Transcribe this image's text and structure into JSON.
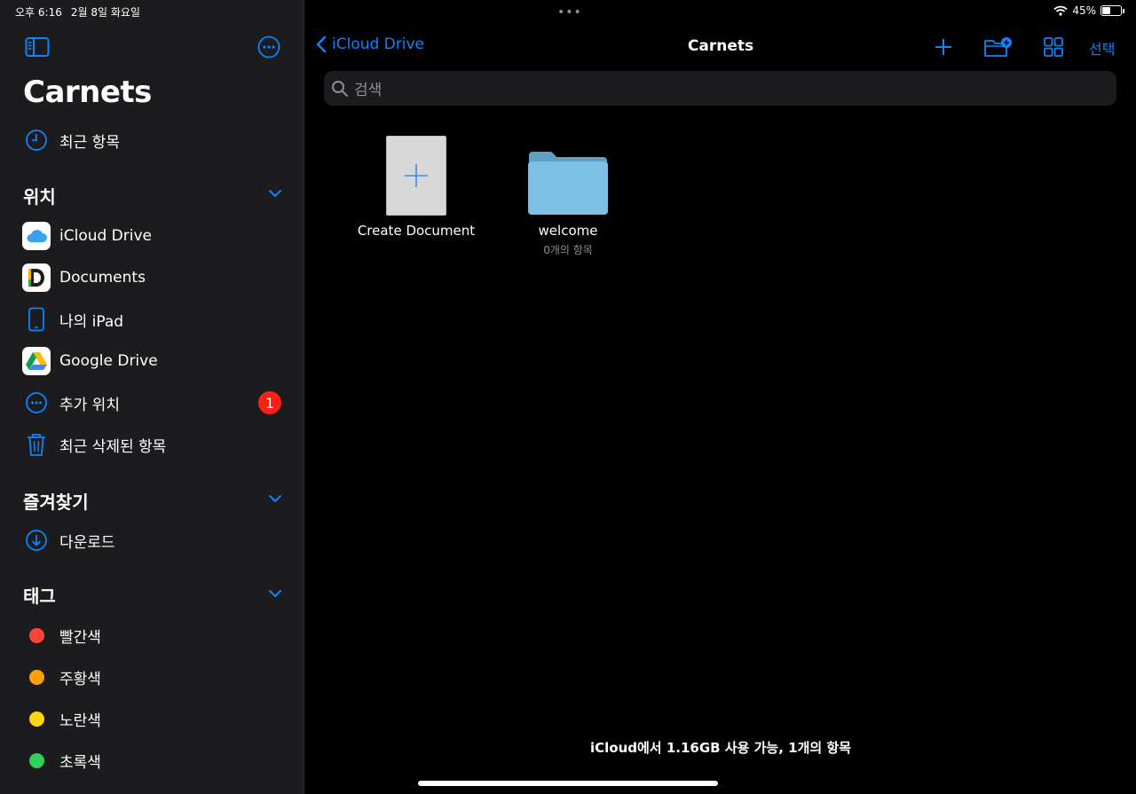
{
  "status": {
    "time": "오후 6:16",
    "date": "2월 8일 화요일",
    "battery": "45%"
  },
  "sidebar": {
    "title": "Carnets",
    "recents": "최근 항목",
    "locations": {
      "heading": "위치",
      "items": [
        {
          "label": "iCloud Drive",
          "icon": "icloud-icon"
        },
        {
          "label": "Documents",
          "icon": "documents-app-icon"
        },
        {
          "label": "나의 iPad",
          "icon": "ipad-icon"
        },
        {
          "label": "Google Drive",
          "icon": "google-drive-icon"
        },
        {
          "label": "추가 위치",
          "icon": "more-locations-icon",
          "badge": "1"
        },
        {
          "label": "최근 삭제된 항목",
          "icon": "trash-icon"
        }
      ]
    },
    "favorites": {
      "heading": "즐겨찾기",
      "items": [
        {
          "label": "다운로드",
          "icon": "download-icon"
        }
      ]
    },
    "tags": {
      "heading": "태그",
      "items": [
        {
          "label": "빨간색",
          "color": "#ff453a"
        },
        {
          "label": "주황색",
          "color": "#ff9f0a"
        },
        {
          "label": "노란색",
          "color": "#ffd60a"
        },
        {
          "label": "초록색",
          "color": "#30d158"
        }
      ]
    }
  },
  "nav": {
    "back_label": "iCloud Drive",
    "title": "Carnets",
    "select_label": "선택"
  },
  "search": {
    "placeholder": "검색"
  },
  "files": [
    {
      "name": "Create Document",
      "type": "create"
    },
    {
      "name": "welcome",
      "type": "folder",
      "subtitle": "0개의 항목"
    }
  ],
  "footer": "iCloud에서 1.16GB 사용 가능, 1개의 항목",
  "colors": {
    "accent": "#0a84ff",
    "sidebar_bg": "#1c1c1e",
    "badge": "#ff1f17"
  }
}
